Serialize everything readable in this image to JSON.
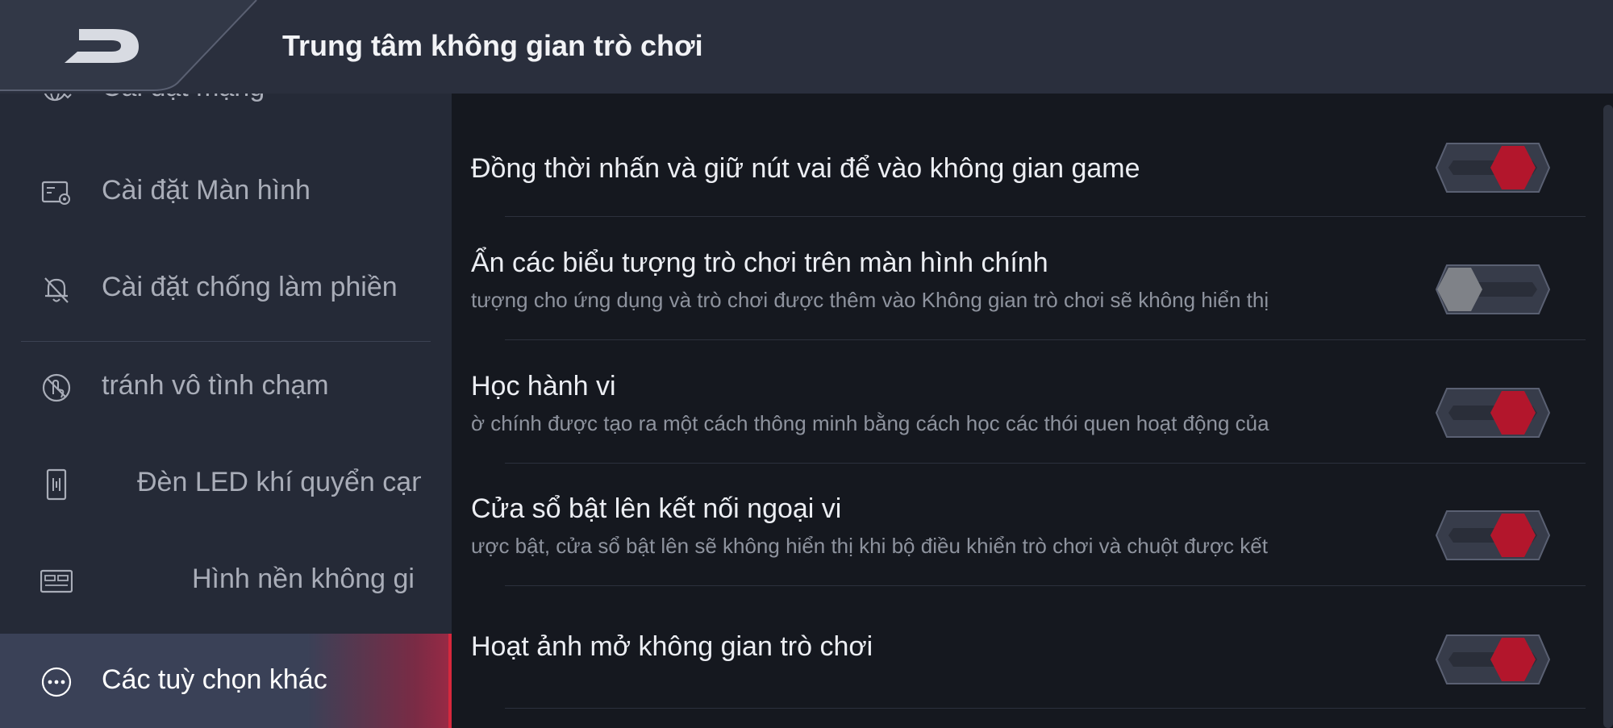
{
  "header": {
    "title": "Trung tâm không gian trò chơi",
    "back_icon": "back-arrow-icon"
  },
  "sidebar": {
    "items": [
      {
        "label": "Cài đặt mạng",
        "icon": "network-settings-icon"
      },
      {
        "label": "Cài đặt Màn hình",
        "icon": "display-settings-icon"
      },
      {
        "label": "Cài đặt chống làm phiền",
        "icon": "bell-off-icon"
      },
      {
        "label": "tránh vô tình chạm",
        "icon": "no-touch-icon"
      },
      {
        "label": "Đèn LED khí quyển cạn",
        "icon": "led-light-icon"
      },
      {
        "label": "Hình nền không gi",
        "icon": "wallpaper-icon"
      },
      {
        "label": "Các tuỳ chọn khác",
        "icon": "more-options-icon",
        "active": true
      }
    ]
  },
  "settings": [
    {
      "title": "Đồng thời nhấn và giữ nút vai để vào không gian game",
      "description": "",
      "enabled": true
    },
    {
      "title": "Ẩn các biểu tượng trò chơi trên màn hình chính",
      "description": "tượng cho ứng dụng và trò chơi được thêm vào Không gian trò chơi sẽ không hiển thị",
      "enabled": false
    },
    {
      "title": "Học hành vi",
      "description": "ờ chính được tạo ra một cách thông minh bằng cách học các thói quen hoạt động của",
      "enabled": true
    },
    {
      "title": "Cửa sổ bật lên kết nối ngoại vi",
      "description": "ược bật, cửa sổ bật lên sẽ không hiển thị khi bộ điều khiển trò chơi và chuột được kết",
      "enabled": true
    },
    {
      "title": "Hoạt ảnh mở không gian trò chơi",
      "description": "",
      "enabled": true
    }
  ],
  "colors": {
    "accent": "#b3162c",
    "toggle_off": "#7f8288",
    "header_bg": "#2a2f3d",
    "sidebar_bg": "#252a37",
    "content_bg": "#15181f"
  }
}
